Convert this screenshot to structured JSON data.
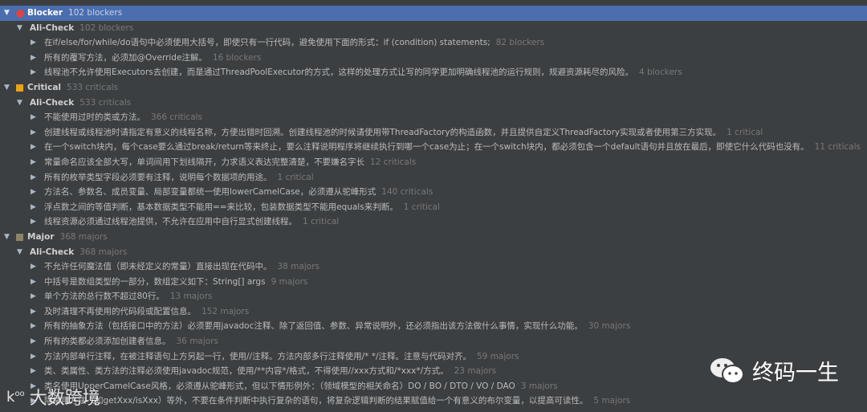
{
  "tree": [
    {
      "level": 0,
      "selected": true,
      "severity": "blocker",
      "label": "Blocker",
      "count": "102 blockers"
    },
    {
      "level": 1,
      "label": "Ali-Check",
      "count": "102 blockers"
    },
    {
      "level": 2,
      "label": "在if/else/for/while/do语句中必须使用大括号，即使只有一行代码，避免使用下面的形式：if (condition) statements;",
      "count": "82 blockers"
    },
    {
      "level": 2,
      "label": "所有的覆写方法，必须加@Override注解。",
      "count": "16 blockers"
    },
    {
      "level": 2,
      "label": "线程池不允许使用Executors去创建，而是通过ThreadPoolExecutor的方式，这样的处理方式让写的同学更加明确线程池的运行规则，规避资源耗尽的风险。",
      "count": "4 blockers"
    },
    {
      "level": 0,
      "severity": "critical",
      "label": "Critical",
      "count": "533 criticals"
    },
    {
      "level": 1,
      "label": "Ali-Check",
      "count": "533 criticals"
    },
    {
      "level": 2,
      "label": "不能使用过时的类或方法。",
      "count": "366 criticals"
    },
    {
      "level": 2,
      "label": "创建线程或线程池时请指定有意义的线程名称，方便出错时回溯。创建线程池的时候请使用带ThreadFactory的构造函数，并且提供自定义ThreadFactory实现或者使用第三方实现。",
      "count": "1 critical"
    },
    {
      "level": 2,
      "label": "在一个switch块内，每个case要么通过break/return等来终止，要么注释说明程序将继续执行到哪一个case为止；在一个switch块内，都必须包含一个default语句并且放在最后，即使它什么代码也没有。",
      "count": "11 criticals"
    },
    {
      "level": 2,
      "label": "常量命名应该全部大写，单词间用下划线隔开，力求语义表达完整清楚，不要嫌名字长",
      "count": "12 criticals"
    },
    {
      "level": 2,
      "label": "所有的枚举类型字段必须要有注释，说明每个数据项的用途。",
      "count": "1 critical"
    },
    {
      "level": 2,
      "label": "方法名、参数名、成员变量、局部变量都统一使用lowerCamelCase，必须遵从驼峰形式",
      "count": "140 criticals"
    },
    {
      "level": 2,
      "label": "浮点数之间的等值判断，基本数据类型不能用==来比较，包装数据类型不能用equals来判断。",
      "count": "1 critical"
    },
    {
      "level": 2,
      "label": "线程资源必须通过线程池提供，不允许在应用中自行显式创建线程。",
      "count": "1 critical"
    },
    {
      "level": 0,
      "severity": "major",
      "label": "Major",
      "count": "368 majors"
    },
    {
      "level": 1,
      "label": "Ali-Check",
      "count": "368 majors"
    },
    {
      "level": 2,
      "label": "不允许任何魔法值（即未经定义的常量）直接出现在代码中。",
      "count": "38 majors"
    },
    {
      "level": 2,
      "label": "中括号是数组类型的一部分，数组定义如下：String[] args",
      "count": "9 majors"
    },
    {
      "level": 2,
      "label": "单个方法的总行数不超过80行。",
      "count": "13 majors"
    },
    {
      "level": 2,
      "label": "及时清理不再使用的代码段或配置信息。",
      "count": "152 majors"
    },
    {
      "level": 2,
      "label": "所有的抽象方法（包括接口中的方法）必须要用javadoc注释、除了返回值、参数、异常说明外，还必须指出该方法做什么事情，实现什么功能。",
      "count": "30 majors"
    },
    {
      "level": 2,
      "label": "所有的类都必须添加创建者信息。",
      "count": "36 majors"
    },
    {
      "level": 2,
      "label": "方法内部单行注释，在被注释语句上方另起一行，使用//注释。方法内部多行注释使用/* */注释。注意与代码对齐。",
      "count": "59 majors"
    },
    {
      "level": 2,
      "label": "类、类属性、类方法的注释必须使用javadoc规范，使用/**内容*/格式，不得使用//xxx方式和/*xxx*/方式。",
      "count": "23 majors"
    },
    {
      "level": 2,
      "label": "类名使用UpperCamelCase风格，必须遵从驼峰形式，但以下情形例外：（领域模型的相关命名）DO / BO / DTO / VO / DAO",
      "count": "3 majors"
    },
    {
      "level": 2,
      "label": "除常用方法（如getXxx/isXxx）等外，不要在条件判断中执行复杂的语句，将复杂逻辑判断的结果赋值给一个有意义的布尔变量，以提高可读性。",
      "count": "5 majors"
    }
  ],
  "icons": {
    "expanded": "▼",
    "collapsed": "▶"
  },
  "colors": {
    "blocker": "#e0443e",
    "critical": "#e8a317",
    "major": "#8c8466",
    "selection": "#4b6eaf"
  },
  "watermarks": {
    "left": "大数跨境",
    "right": "终码一生"
  }
}
